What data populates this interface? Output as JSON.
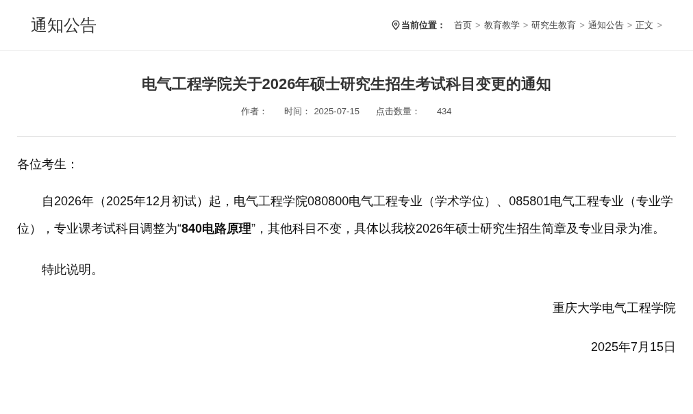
{
  "header": {
    "title": "通知公告",
    "location_label": "当前位置：",
    "breadcrumbs": [
      {
        "label": "首页",
        "sep": ">"
      },
      {
        "label": "教育教学",
        "sep": ">"
      },
      {
        "label": "研究生教育",
        "sep": ">"
      },
      {
        "label": "通知公告",
        "sep": ">"
      },
      {
        "label": "正文",
        "sep": ">"
      }
    ]
  },
  "article": {
    "title": "电气工程学院关于2026年硕士研究生招生考试科目变更的通知",
    "meta": [
      {
        "label": "作者："
      },
      {
        "label": "时间：",
        "value": "2025-07-15"
      },
      {
        "label": "点击数量：",
        "value": "434"
      }
    ],
    "greeting": "各位考生：",
    "paragraphs": [
      "自2026年（2025年12月初试）起，电气工程学院080800电气工程专业（学术学位）、085801电气工程专业（专业学位），专业课考试科目调整为“**840电路原理**”，其他科目不变，具体以我校2026年硕士研究生招生简章及专业目录为准。",
      "特此说明。"
    ],
    "signature": "重庆大学电气工程学院",
    "date": "2025年7月15日"
  }
}
